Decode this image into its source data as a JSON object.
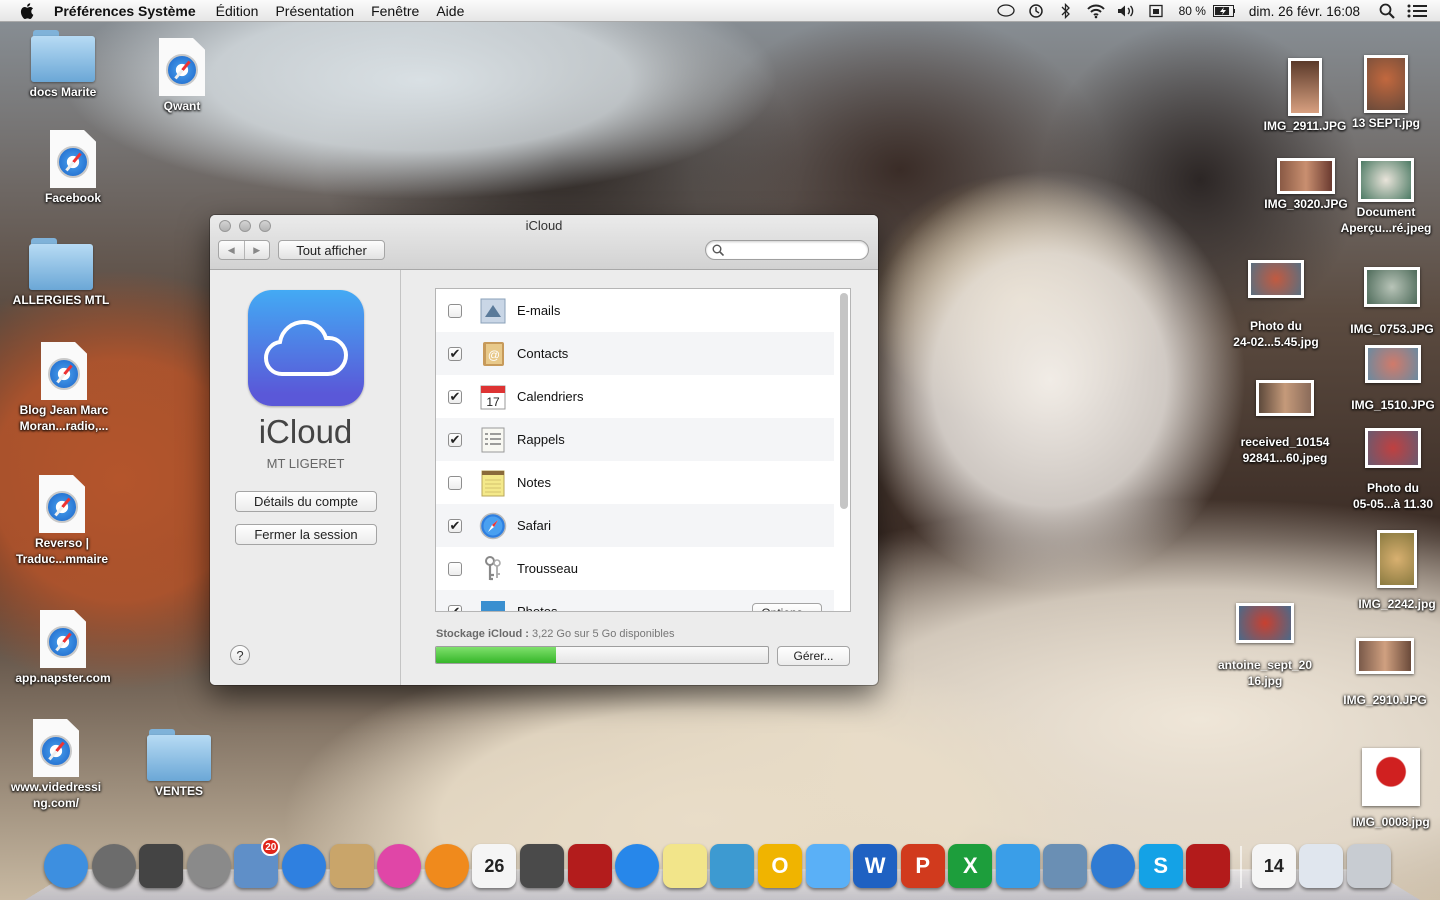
{
  "menubar": {
    "app_name": "Préférences Système",
    "menus": [
      "Édition",
      "Présentation",
      "Fenêtre",
      "Aide"
    ],
    "battery_percent": "80 %",
    "clock": "dim. 26 févr.  16:08"
  },
  "desktop": {
    "left_icons": [
      {
        "label": "docs Marite",
        "kind": "folder"
      },
      {
        "label": "Qwant",
        "kind": "webloc"
      },
      {
        "label": "Facebook",
        "kind": "webloc"
      },
      {
        "label": "ALLERGIES MTL",
        "kind": "folder"
      },
      {
        "label": "Blog Jean Marc\nMoran...radio,...",
        "kind": "webloc"
      },
      {
        "label": "Reverso |\nTraduc...mmaire",
        "kind": "webloc"
      },
      {
        "label": "app.napster.com",
        "kind": "webloc"
      },
      {
        "label": "www.videdressi\nng.com/",
        "kind": "webloc"
      },
      {
        "label": "VENTES",
        "kind": "folder"
      }
    ],
    "right_icons": [
      {
        "label": "IMG_2911.JPG"
      },
      {
        "label": "13 SEPT.jpg"
      },
      {
        "label": "IMG_3020.JPG"
      },
      {
        "label": "Document\nAperçu...ré.jpeg"
      },
      {
        "label": "Photo du\n24-02...5.45.jpg"
      },
      {
        "label": "IMG_0753.JPG"
      },
      {
        "label": "IMG_1510.JPG"
      },
      {
        "label": "received_10154\n92841...60.jpeg"
      },
      {
        "label": "Photo du\n05-05...à 11.30"
      },
      {
        "label": "IMG_2242.jpg"
      },
      {
        "label": "antoine_sept_20\n16.jpg"
      },
      {
        "label": "IMG_2910.JPG"
      },
      {
        "label": "IMG_0008.jpg"
      }
    ]
  },
  "window": {
    "title": "iCloud",
    "nav_back": "◀",
    "nav_forward": "▶",
    "show_all": "Tout afficher",
    "search_placeholder": "",
    "product_name": "iCloud",
    "account_name": "MT LIGERET",
    "account_details_button": "Détails du compte",
    "sign_out_button": "Fermer la session",
    "help": "?",
    "services": [
      {
        "label": "E-mails",
        "checked": false
      },
      {
        "label": "Contacts",
        "checked": true
      },
      {
        "label": "Calendriers",
        "checked": true
      },
      {
        "label": "Rappels",
        "checked": true
      },
      {
        "label": "Notes",
        "checked": false
      },
      {
        "label": "Safari",
        "checked": true
      },
      {
        "label": "Trousseau",
        "checked": false
      },
      {
        "label": "Photos",
        "checked": true
      }
    ],
    "options_button": "Options...",
    "calendar_day": "17",
    "storage_title": "Stockage iCloud :",
    "storage_text": "3,22 Go sur 5 Go disponibles",
    "storage_fraction": 0.36,
    "manage_button": "Gérer..."
  },
  "dock": {
    "items": [
      {
        "name": "finder",
        "color": "#3d8fe0"
      },
      {
        "name": "launchpad",
        "color": "#6c6c6c"
      },
      {
        "name": "mission-control",
        "color": "#444"
      },
      {
        "name": "system-preferences",
        "color": "#8a8a8a"
      },
      {
        "name": "mail",
        "color": "#5f8fc8",
        "badge": "20"
      },
      {
        "name": "safari",
        "color": "#2f80e0"
      },
      {
        "name": "contacts",
        "color": "#c9a56a"
      },
      {
        "name": "itunes",
        "color": "#e046a7"
      },
      {
        "name": "ibooks",
        "color": "#f08a1c"
      },
      {
        "name": "calendar",
        "color": "#f5f5f5",
        "text": "26"
      },
      {
        "name": "facetime",
        "color": "#4a4a4a"
      },
      {
        "name": "photo-booth",
        "color": "#b31c1c"
      },
      {
        "name": "app-store",
        "color": "#2787ea"
      },
      {
        "name": "stickies",
        "color": "#f2e58a"
      },
      {
        "name": "iphoto",
        "color": "#3d9ad1"
      },
      {
        "name": "outlook",
        "color": "#f0b400",
        "text": "O"
      },
      {
        "name": "messages",
        "color": "#5ab0f7"
      },
      {
        "name": "word",
        "color": "#1f61c2",
        "text": "W"
      },
      {
        "name": "powerpoint",
        "color": "#d13a1d",
        "text": "P"
      },
      {
        "name": "excel",
        "color": "#1d9e3c",
        "text": "X"
      },
      {
        "name": "messenger",
        "color": "#3a9ee8"
      },
      {
        "name": "network",
        "color": "#6a8fb4"
      },
      {
        "name": "downloads-globe",
        "color": "#2f7bd3"
      },
      {
        "name": "skype",
        "color": "#14a2e6",
        "text": "S"
      },
      {
        "name": "acrobat",
        "color": "#b31b1b"
      },
      {
        "name": "calendar-small",
        "color": "#f5f5f5",
        "text": "14"
      },
      {
        "name": "mail-doc",
        "color": "#e0e6ee"
      },
      {
        "name": "trash",
        "color": "#c8ccd2"
      }
    ]
  }
}
